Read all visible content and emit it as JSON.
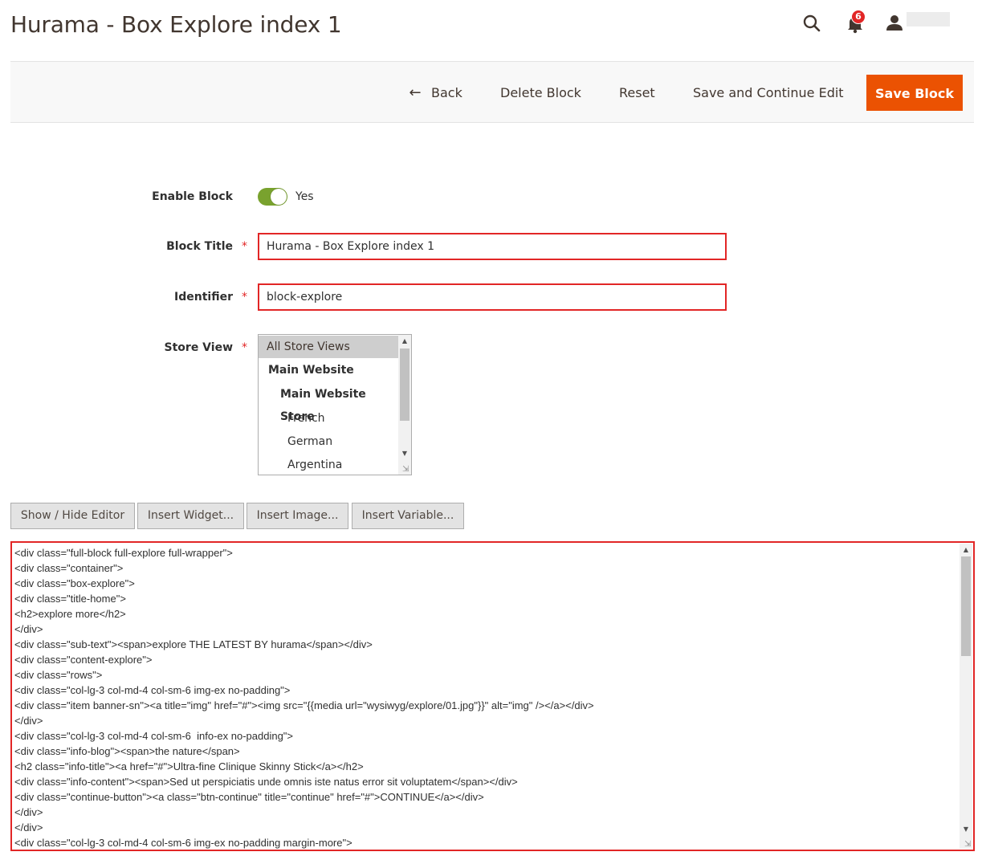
{
  "page": {
    "title": "Hurama - Box Explore index 1"
  },
  "header": {
    "notifications_count": "6"
  },
  "actions": {
    "back": "Back",
    "delete": "Delete Block",
    "reset": "Reset",
    "save_continue": "Save and Continue Edit",
    "save": "Save Block"
  },
  "form": {
    "enable_label": "Enable Block",
    "enable_value": "Yes",
    "title_label": "Block Title",
    "title_value": "Hurama - Box Explore index 1",
    "identifier_label": "Identifier",
    "identifier_value": "block-explore",
    "store_label": "Store View",
    "required_mark": "*",
    "store_options": [
      "All Store Views",
      "Main Website",
      "Main Website Store",
      "French",
      "German",
      "Argentina"
    ]
  },
  "editor": {
    "buttons": [
      "Show / Hide Editor",
      "Insert Widget...",
      "Insert Image...",
      "Insert Variable..."
    ],
    "lines": [
      "<div class=\"full-block full-explore full-wrapper\">",
      "<div class=\"container\">",
      "<div class=\"box-explore\">",
      "<div class=\"title-home\">",
      "<h2>explore more</h2>",
      "</div>",
      "<div class=\"sub-text\"><span>explore THE LATEST BY hurama</span></div>",
      "<div class=\"content-explore\">",
      "<div class=\"rows\">",
      "<div class=\"col-lg-3 col-md-4 col-sm-6 img-ex no-padding\">",
      "<div class=\"item banner-sn\"><a title=\"img\" href=\"#\"><img src=\"{{media url=\"wysiwyg/explore/01.jpg\"}}\" alt=\"img\" /></a></div>",
      "</div>",
      "<div class=\"col-lg-3 col-md-4 col-sm-6  info-ex no-padding\">",
      "<div class=\"info-blog\"><span>the nature</span>",
      "<h2 class=\"info-title\"><a href=\"#\">Ultra-fine Clinique Skinny Stick</a></h2>",
      "<div class=\"info-content\"><span>Sed ut perspiciatis unde omnis iste natus error sit voluptatem</span></div>",
      "<div class=\"continue-button\"><a class=\"btn-continue\" title=\"continue\" href=\"#\">CONTINUE</a></div>",
      "</div>",
      "</div>",
      "<div class=\"col-lg-3 col-md-4 col-sm-6 img-ex no-padding margin-more\">"
    ]
  },
  "colors": {
    "accent": "#eb5202",
    "toggle_on": "#79a22e",
    "error": "#e22626"
  }
}
